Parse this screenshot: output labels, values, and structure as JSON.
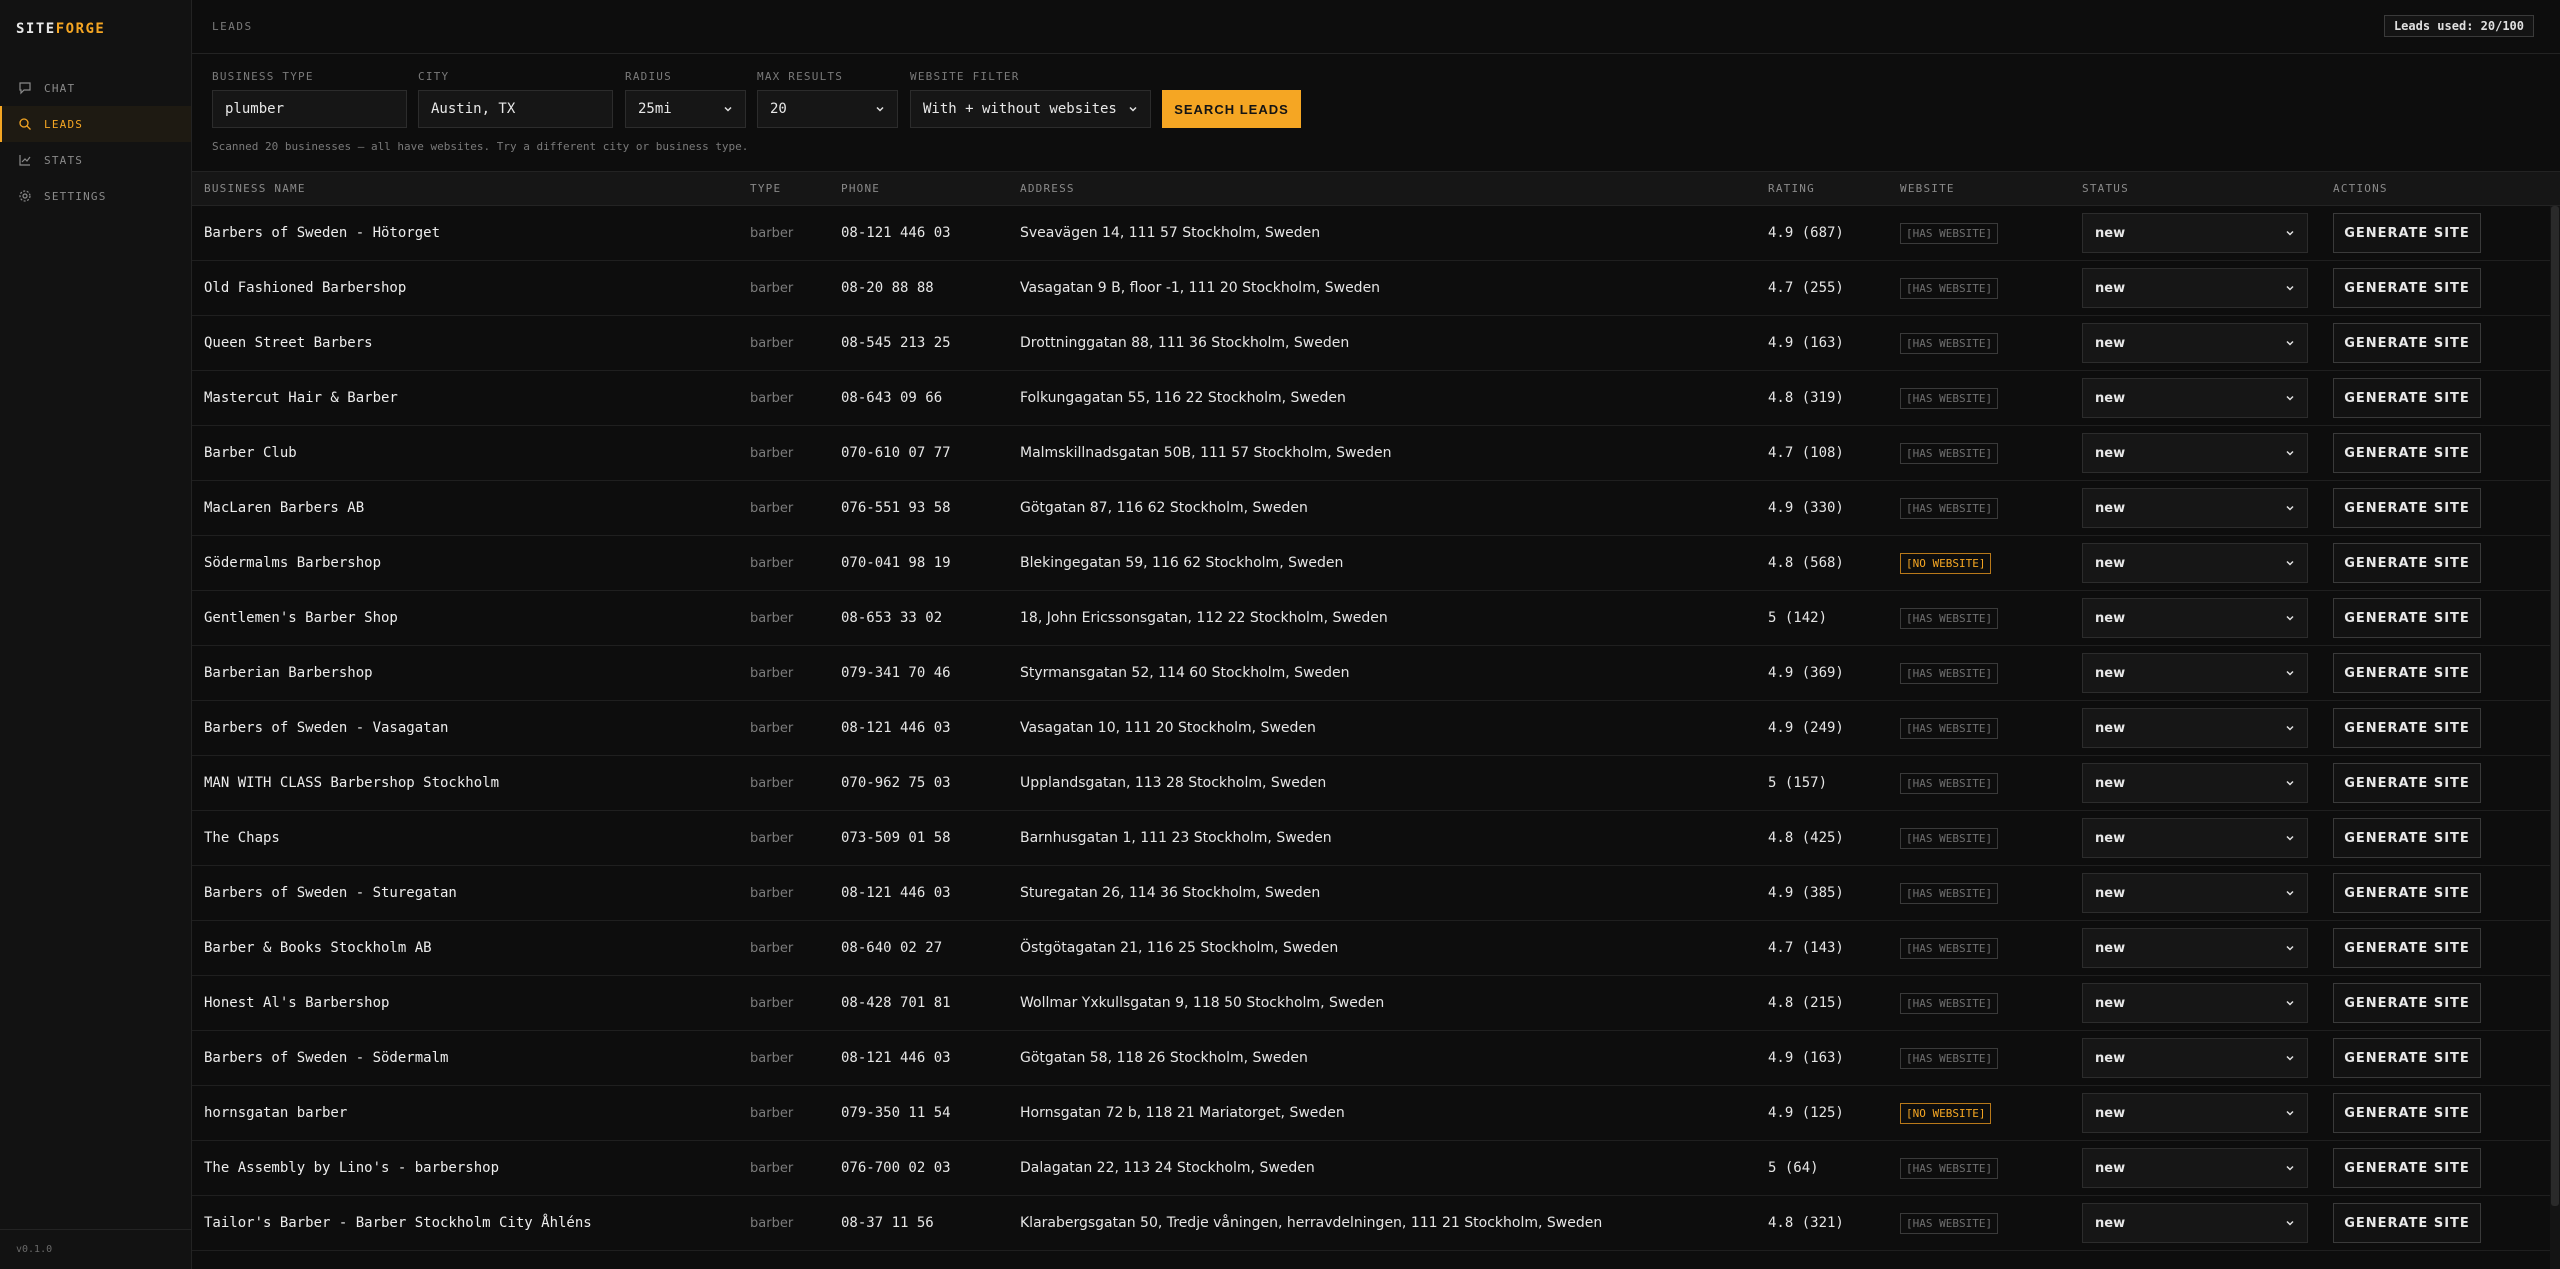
{
  "app": {
    "logo_part1": "SITE",
    "logo_part2": "FORGE",
    "version": "v0.1.0"
  },
  "nav": [
    {
      "label": "CHAT",
      "icon": "chat-icon",
      "active": false
    },
    {
      "label": "LEADS",
      "icon": "search-icon",
      "active": true
    },
    {
      "label": "STATS",
      "icon": "chart-icon",
      "active": false
    },
    {
      "label": "SETTINGS",
      "icon": "gear-icon",
      "active": false
    }
  ],
  "header": {
    "title": "LEADS",
    "usage": "Leads used: 20/100"
  },
  "filters": {
    "business_type_label": "BUSINESS TYPE",
    "business_type_value": "plumber",
    "city_label": "CITY",
    "city_value": "Austin, TX",
    "radius_label": "RADIUS",
    "radius_value": "25mi",
    "max_results_label": "MAX RESULTS",
    "max_results_value": "20",
    "website_filter_label": "WEBSITE FILTER",
    "website_filter_value": "With + without websites",
    "search_button": "SEARCH LEADS",
    "scan_message": "Scanned 20 businesses — all have websites. Try a different city or business type."
  },
  "table": {
    "headers": {
      "name": "BUSINESS NAME",
      "type": "TYPE",
      "phone": "PHONE",
      "address": "ADDRESS",
      "rating": "RATING",
      "website": "WEBSITE",
      "status": "STATUS",
      "actions": "ACTIONS"
    },
    "action_label": "GENERATE SITE",
    "rows": [
      {
        "name": "Barbers of Sweden - Hötorget",
        "type": "barber",
        "phone": "08-121 446 03",
        "address": "Sveavägen 14, 111 57 Stockholm, Sweden",
        "rating": "4.9 (687)",
        "website": "[HAS WEBSITE]",
        "has_site": true,
        "status": "new"
      },
      {
        "name": "Old Fashioned Barbershop",
        "type": "barber",
        "phone": "08-20 88 88",
        "address": "Vasagatan 9 B, floor -1, 111 20 Stockholm, Sweden",
        "rating": "4.7 (255)",
        "website": "[HAS WEBSITE]",
        "has_site": true,
        "status": "new"
      },
      {
        "name": "Queen Street Barbers",
        "type": "barber",
        "phone": "08-545 213 25",
        "address": "Drottninggatan 88, 111 36 Stockholm, Sweden",
        "rating": "4.9 (163)",
        "website": "[HAS WEBSITE]",
        "has_site": true,
        "status": "new"
      },
      {
        "name": "Mastercut Hair & Barber",
        "type": "barber",
        "phone": "08-643 09 66",
        "address": "Folkungagatan 55, 116 22 Stockholm, Sweden",
        "rating": "4.8 (319)",
        "website": "[HAS WEBSITE]",
        "has_site": true,
        "status": "new"
      },
      {
        "name": "Barber Club",
        "type": "barber",
        "phone": "070-610 07 77",
        "address": "Malmskillnadsgatan 50B, 111 57 Stockholm, Sweden",
        "rating": "4.7 (108)",
        "website": "[HAS WEBSITE]",
        "has_site": true,
        "status": "new"
      },
      {
        "name": "MacLaren Barbers AB",
        "type": "barber",
        "phone": "076-551 93 58",
        "address": "Götgatan 87, 116 62 Stockholm, Sweden",
        "rating": "4.9 (330)",
        "website": "[HAS WEBSITE]",
        "has_site": true,
        "status": "new"
      },
      {
        "name": "Södermalms Barbershop",
        "type": "barber",
        "phone": "070-041 98 19",
        "address": "Blekingegatan 59, 116 62 Stockholm, Sweden",
        "rating": "4.8 (568)",
        "website": "[NO WEBSITE]",
        "has_site": false,
        "status": "new"
      },
      {
        "name": "Gentlemen's Barber Shop",
        "type": "barber",
        "phone": "08-653 33 02",
        "address": "18, John Ericssonsgatan, 112 22 Stockholm, Sweden",
        "rating": "5 (142)",
        "website": "[HAS WEBSITE]",
        "has_site": true,
        "status": "new"
      },
      {
        "name": "Barberian Barbershop",
        "type": "barber",
        "phone": "079-341 70 46",
        "address": "Styrmansgatan 52, 114 60 Stockholm, Sweden",
        "rating": "4.9 (369)",
        "website": "[HAS WEBSITE]",
        "has_site": true,
        "status": "new"
      },
      {
        "name": "Barbers of Sweden - Vasagatan",
        "type": "barber",
        "phone": "08-121 446 03",
        "address": "Vasagatan 10, 111 20 Stockholm, Sweden",
        "rating": "4.9 (249)",
        "website": "[HAS WEBSITE]",
        "has_site": true,
        "status": "new"
      },
      {
        "name": "MAN WITH CLASS Barbershop Stockholm",
        "type": "barber",
        "phone": "070-962 75 03",
        "address": "Upplandsgatan, 113 28 Stockholm, Sweden",
        "rating": "5 (157)",
        "website": "[HAS WEBSITE]",
        "has_site": true,
        "status": "new"
      },
      {
        "name": "The Chaps",
        "type": "barber",
        "phone": "073-509 01 58",
        "address": "Barnhusgatan 1, 111 23 Stockholm, Sweden",
        "rating": "4.8 (425)",
        "website": "[HAS WEBSITE]",
        "has_site": true,
        "status": "new"
      },
      {
        "name": "Barbers of Sweden - Sturegatan",
        "type": "barber",
        "phone": "08-121 446 03",
        "address": "Sturegatan 26, 114 36 Stockholm, Sweden",
        "rating": "4.9 (385)",
        "website": "[HAS WEBSITE]",
        "has_site": true,
        "status": "new"
      },
      {
        "name": "Barber & Books Stockholm AB",
        "type": "barber",
        "phone": "08-640 02 27",
        "address": "Östgötagatan 21, 116 25 Stockholm, Sweden",
        "rating": "4.7 (143)",
        "website": "[HAS WEBSITE]",
        "has_site": true,
        "status": "new"
      },
      {
        "name": "Honest Al's Barbershop",
        "type": "barber",
        "phone": "08-428 701 81",
        "address": "Wollmar Yxkullsgatan 9, 118 50 Stockholm, Sweden",
        "rating": "4.8 (215)",
        "website": "[HAS WEBSITE]",
        "has_site": true,
        "status": "new"
      },
      {
        "name": "Barbers of Sweden - Södermalm",
        "type": "barber",
        "phone": "08-121 446 03",
        "address": "Götgatan 58, 118 26 Stockholm, Sweden",
        "rating": "4.9 (163)",
        "website": "[HAS WEBSITE]",
        "has_site": true,
        "status": "new"
      },
      {
        "name": "hornsgatan barber",
        "type": "barber",
        "phone": "079-350 11 54",
        "address": "Hornsgatan 72 b, 118 21 Mariatorget, Sweden",
        "rating": "4.9 (125)",
        "website": "[NO WEBSITE]",
        "has_site": false,
        "status": "new"
      },
      {
        "name": "The Assembly by Lino's - barbershop",
        "type": "barber",
        "phone": "076-700 02 03",
        "address": "Dalagatan 22, 113 24 Stockholm, Sweden",
        "rating": "5 (64)",
        "website": "[HAS WEBSITE]",
        "has_site": true,
        "status": "new"
      },
      {
        "name": "Tailor's Barber - Barber Stockholm City Åhléns",
        "type": "barber",
        "phone": "08-37 11 56",
        "address": "Klarabergsgatan 50, Tredje våningen, herravdelningen, 111 21 Stockholm, Sweden",
        "rating": "4.8 (321)",
        "website": "[HAS WEBSITE]",
        "has_site": true,
        "status": "new"
      }
    ]
  },
  "colors": {
    "accent": "#f5a623",
    "background": "#0d0d0d"
  }
}
